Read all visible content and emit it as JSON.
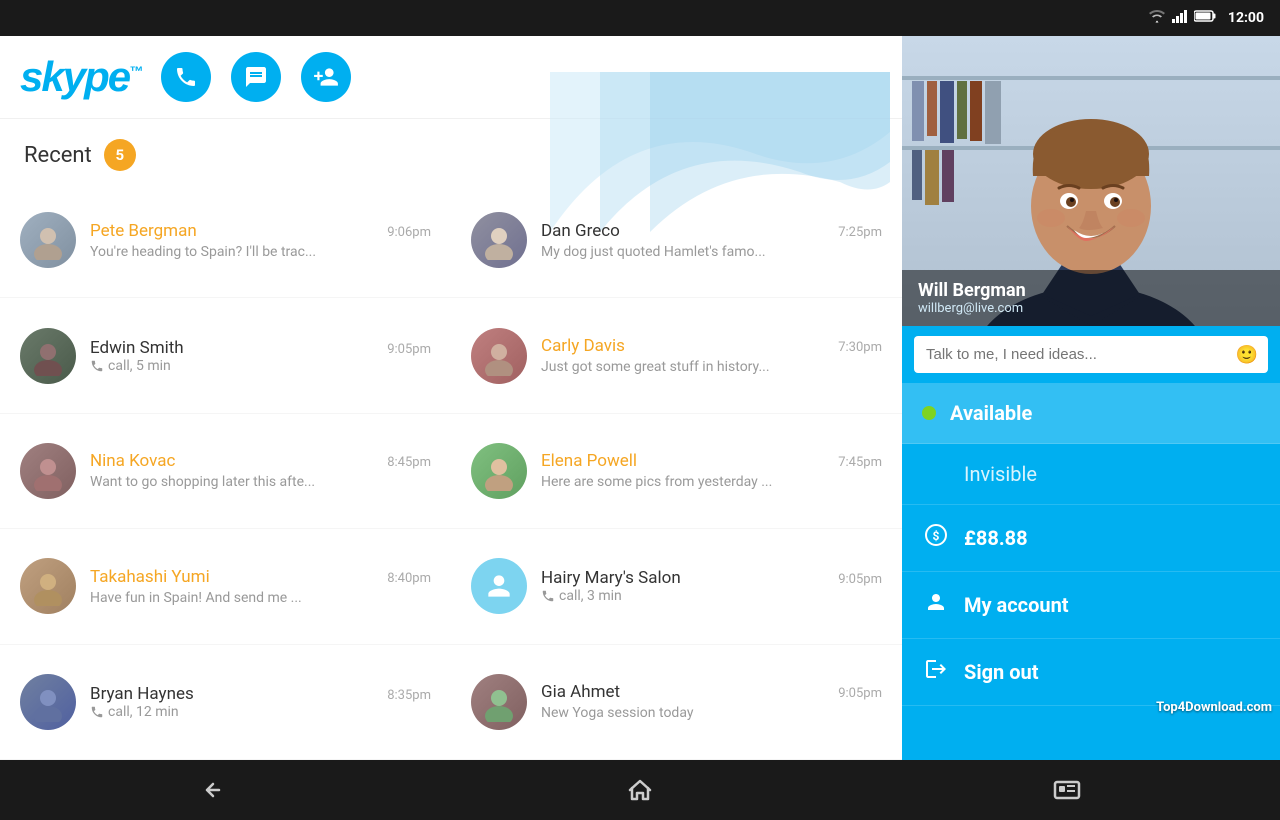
{
  "statusBar": {
    "time": "12:00",
    "wifiIcon": "wifi",
    "signalIcon": "signal",
    "batteryIcon": "battery"
  },
  "header": {
    "logoText": "skype",
    "logoTm": "™",
    "callBtn": "call",
    "chatBtn": "chat",
    "addBtn": "add-person"
  },
  "recent": {
    "label": "Recent",
    "count": "5"
  },
  "contacts": [
    {
      "id": 1,
      "name": "Pete Bergman",
      "nameStyle": "orange",
      "preview": "You're heading to Spain? I'll be trac...",
      "time": "9:06pm",
      "avatarClass": "av1",
      "type": "message"
    },
    {
      "id": 2,
      "name": "Dan Greco",
      "nameStyle": "normal",
      "preview": "My dog just quoted Hamlet's famo...",
      "time": "7:25pm",
      "avatarClass": "av6",
      "type": "message"
    },
    {
      "id": 3,
      "name": "Edwin Smith",
      "nameStyle": "normal",
      "preview": "call, 5 min",
      "time": "9:05pm",
      "avatarClass": "av2",
      "type": "call"
    },
    {
      "id": 4,
      "name": "Carly Davis",
      "nameStyle": "orange",
      "preview": "Just got some great stuff in history...",
      "time": "7:30pm",
      "avatarClass": "av3",
      "type": "message"
    },
    {
      "id": 5,
      "name": "Nina Kovac",
      "nameStyle": "orange",
      "preview": "Want to go shopping later this afte...",
      "time": "8:45pm",
      "avatarClass": "av4",
      "type": "message"
    },
    {
      "id": 6,
      "name": "Elena Powell",
      "nameStyle": "orange",
      "preview": "Here are some pics from yesterday ...",
      "time": "7:45pm",
      "avatarClass": "av8",
      "type": "message"
    },
    {
      "id": 7,
      "name": "Takahashi Yumi",
      "nameStyle": "orange",
      "preview": "Have fun in Spain! And send me ...",
      "time": "8:40pm",
      "avatarClass": "av7",
      "type": "message"
    },
    {
      "id": 8,
      "name": "Hairy Mary's Salon",
      "nameStyle": "normal",
      "preview": "call, 3 min",
      "time": "9:05pm",
      "avatarClass": "placeholder",
      "type": "call"
    },
    {
      "id": 9,
      "name": "Bryan Haynes",
      "nameStyle": "normal",
      "preview": "call, 12 min",
      "time": "8:35pm",
      "avatarClass": "av5",
      "type": "call"
    },
    {
      "id": 10,
      "name": "Gia Ahmet",
      "nameStyle": "normal",
      "preview": "New Yoga session today",
      "time": "9:05pm",
      "avatarClass": "av4",
      "type": "message"
    }
  ],
  "rightPanel": {
    "userName": "Will Bergman",
    "userEmail": "willberg@live.com",
    "moodPlaceholder": "Talk to me, I need ideas...",
    "menuItems": [
      {
        "id": "available",
        "label": "Available",
        "labelStyle": "bold",
        "iconType": "dot",
        "selected": true
      },
      {
        "id": "invisible",
        "label": "Invisible",
        "labelStyle": "light",
        "iconType": "none",
        "selected": false
      },
      {
        "id": "credit",
        "label": "£88.88",
        "labelStyle": "bold",
        "iconType": "credit",
        "selected": false
      },
      {
        "id": "myaccount",
        "label": "My account",
        "labelStyle": "bold",
        "iconType": "person",
        "selected": false
      },
      {
        "id": "signout",
        "label": "Sign out",
        "labelStyle": "bold",
        "iconType": "signout",
        "selected": false
      }
    ]
  },
  "navBar": {
    "backBtn": "←",
    "homeBtn": "⌂",
    "recentBtn": "▭"
  },
  "watermark": "Top4Download.com"
}
